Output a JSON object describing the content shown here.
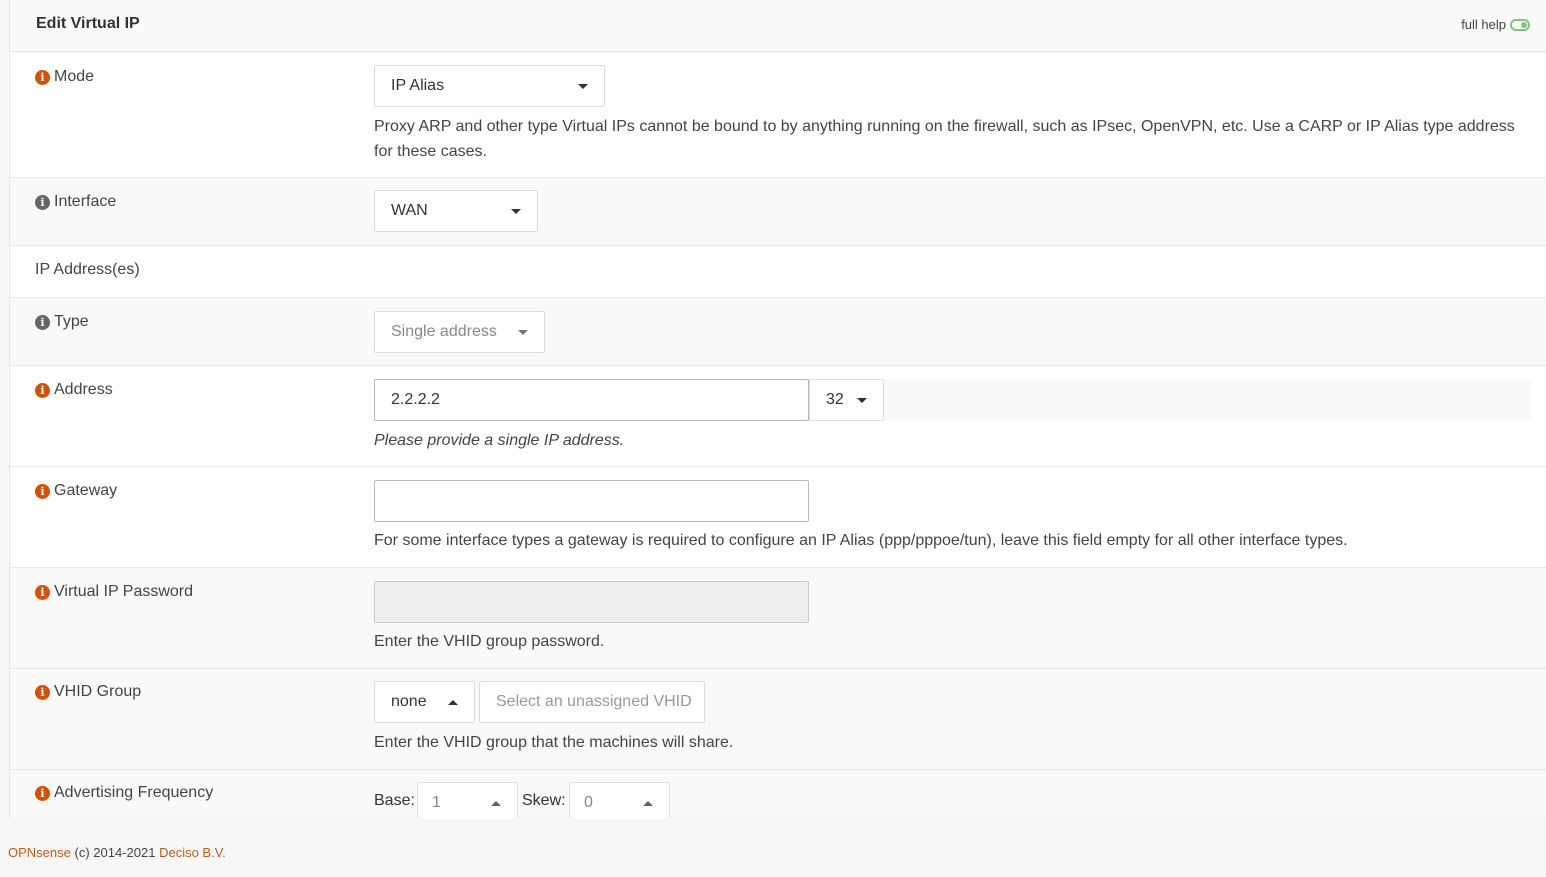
{
  "header": {
    "title": "Edit Virtual IP",
    "full_help_label": "full help"
  },
  "fields": {
    "mode": {
      "label": "Mode",
      "value": "IP Alias",
      "help": "Proxy ARP and other type Virtual IPs cannot be bound to by anything running on the firewall, such as IPsec, OpenVPN, etc. Use a CARP or IP Alias type address for these cases."
    },
    "interface": {
      "label": "Interface",
      "value": "WAN"
    },
    "ip_section": {
      "label": "IP Address(es)"
    },
    "type": {
      "label": "Type",
      "value": "Single address"
    },
    "address": {
      "label": "Address",
      "value": "2.2.2.2",
      "mask": "32",
      "help": "Please provide a single IP address."
    },
    "gateway": {
      "label": "Gateway",
      "value": "",
      "help": "For some interface types a gateway is required to configure an IP Alias (ppp/pppoe/tun), leave this field empty for all other interface types."
    },
    "password": {
      "label": "Virtual IP Password",
      "value": "",
      "help": "Enter the VHID group password."
    },
    "vhid": {
      "label": "VHID Group",
      "value": "none",
      "unassigned_placeholder": "Select an unassigned VHID",
      "help": "Enter the VHID group that the machines will share."
    },
    "advertising": {
      "label": "Advertising Frequency",
      "base_label": "Base:",
      "base_value": "1",
      "skew_label": "Skew:",
      "skew_value": "0"
    }
  },
  "footer": {
    "brand": "OPNsense",
    "copyright": "(c) 2014-2021",
    "company": "Deciso B.V."
  },
  "colors": {
    "info_icon": "#d94f00",
    "toggle": "#7ac87a",
    "link": "#c35a15"
  }
}
